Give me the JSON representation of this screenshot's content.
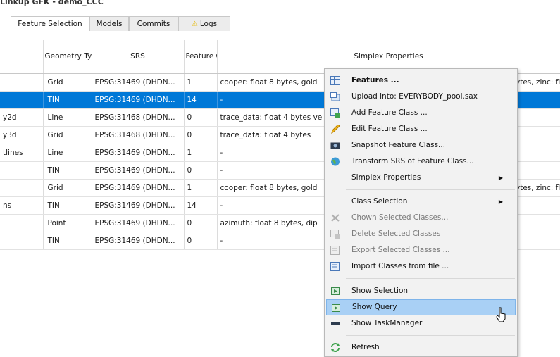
{
  "breadcrumb": "Linkup GFK - demo_CCC",
  "tabs": [
    {
      "label": "Feature Selection",
      "active": true
    },
    {
      "label": "Models",
      "active": false
    },
    {
      "label": "Commits",
      "active": false
    },
    {
      "label": "Logs",
      "active": false,
      "icon": "warning-icon"
    }
  ],
  "columns": [
    "",
    "Geometry Type",
    "SRS",
    "Feature Count",
    "Simplex Properties"
  ],
  "rows": [
    {
      "name": "l",
      "geometry": "Grid",
      "srs": "EPSG:31469 (DHDN...",
      "count": "1",
      "props": "cooper: float 8 bytes, gold",
      "props_right": "ytes, zinc: fl",
      "selected": false
    },
    {
      "name": "",
      "geometry": "TIN",
      "srs": "EPSG:31469 (DHDN...",
      "count": "14",
      "props": "-",
      "props_right": "",
      "selected": true
    },
    {
      "name": "y2d",
      "geometry": "Line",
      "srs": "EPSG:31468 (DHDN...",
      "count": "0",
      "props": "trace_data: float 4 bytes ve",
      "props_right": "",
      "selected": false
    },
    {
      "name": "y3d",
      "geometry": "Grid",
      "srs": "EPSG:31468 (DHDN...",
      "count": "0",
      "props": "trace_data: float 4 bytes",
      "props_right": "",
      "selected": false
    },
    {
      "name": "tlines",
      "geometry": "Line",
      "srs": "EPSG:31469 (DHDN...",
      "count": "1",
      "props": "-",
      "props_right": "",
      "selected": false
    },
    {
      "name": "",
      "geometry": "TIN",
      "srs": "EPSG:31469 (DHDN...",
      "count": "0",
      "props": "-",
      "props_right": "",
      "selected": false
    },
    {
      "name": "",
      "geometry": "Grid",
      "srs": "EPSG:31469 (DHDN...",
      "count": "1",
      "props": "cooper: float 8 bytes, gold",
      "props_right": "ytes, zinc: fl",
      "selected": false
    },
    {
      "name": "ns",
      "geometry": "TIN",
      "srs": "EPSG:31469 (DHDN...",
      "count": "14",
      "props": "-",
      "props_right": "",
      "selected": false
    },
    {
      "name": "",
      "geometry": "Point",
      "srs": "EPSG:31469 (DHDN...",
      "count": "0",
      "props": "azimuth: float 8 bytes, dip",
      "props_right": "",
      "selected": false
    },
    {
      "name": "",
      "geometry": "TIN",
      "srs": "EPSG:31469 (DHDN...",
      "count": "0",
      "props": "-",
      "props_right": "",
      "selected": false
    }
  ],
  "context_menu": {
    "items": [
      {
        "label": "Features ...",
        "icon": "table-icon",
        "bold": true,
        "disabled": false
      },
      {
        "label": "Upload into: EVERYBODY_pool.sax",
        "icon": "upload-icon",
        "bold": false,
        "disabled": false
      },
      {
        "label": "Add Feature Class ...",
        "icon": "add-class-icon",
        "bold": false,
        "disabled": false
      },
      {
        "label": "Edit Feature Class ...",
        "icon": "pencil-icon",
        "bold": false,
        "disabled": false
      },
      {
        "label": "Snapshot Feature Class...",
        "icon": "camera-icon",
        "bold": false,
        "disabled": false
      },
      {
        "label": "Transform SRS of Feature Class...",
        "icon": "globe-icon",
        "bold": false,
        "disabled": false
      },
      {
        "label": "Simplex Properties",
        "icon": "",
        "bold": false,
        "disabled": false,
        "submenu": true
      },
      {
        "label": "Class Selection",
        "icon": "",
        "bold": false,
        "disabled": false,
        "submenu": true
      },
      {
        "label": "Chown Selected Classes...",
        "icon": "chown-icon",
        "bold": false,
        "disabled": true
      },
      {
        "label": "Delete Selected Classes",
        "icon": "delete-icon",
        "bold": false,
        "disabled": true
      },
      {
        "label": "Export Selected Classes ...",
        "icon": "export-icon",
        "bold": false,
        "disabled": true
      },
      {
        "label": "Import Classes from file ...",
        "icon": "import-icon",
        "bold": false,
        "disabled": false
      },
      {
        "label": "Show Selection",
        "icon": "show-selection-icon",
        "bold": false,
        "disabled": false
      },
      {
        "label": "Show Query",
        "icon": "show-query-icon",
        "bold": false,
        "disabled": false,
        "hover": true
      },
      {
        "label": "Show TaskManager",
        "icon": "taskmanager-icon",
        "bold": false,
        "disabled": false
      },
      {
        "label": "Refresh",
        "icon": "refresh-icon",
        "bold": false,
        "disabled": false
      }
    ]
  },
  "colors": {
    "selection": "#0078d7",
    "hover": "#a9d0f5",
    "menu_bg": "#f2f2f2"
  }
}
